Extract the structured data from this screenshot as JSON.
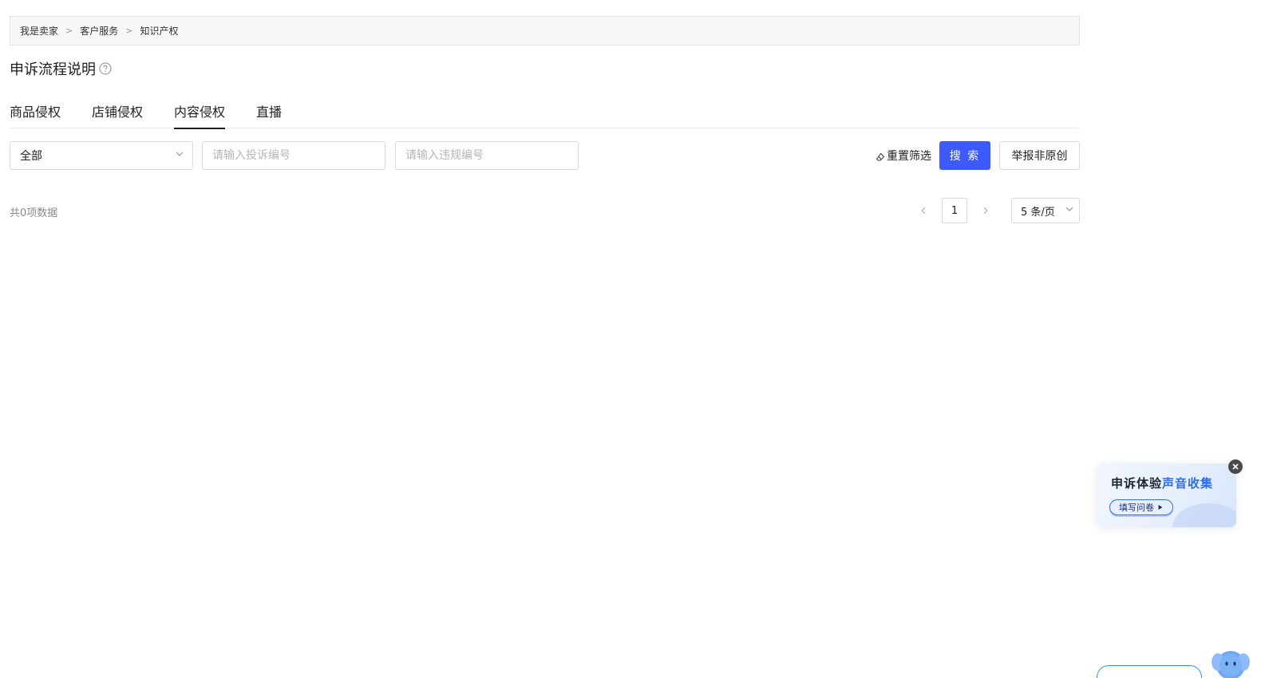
{
  "breadcrumb": {
    "items": [
      "我是卖家",
      "客户服务",
      "知识产权"
    ],
    "separator": ">"
  },
  "page": {
    "title": "申诉流程说明",
    "help_icon": "question-circle-icon"
  },
  "tabs": {
    "items": [
      "商品侵权",
      "店铺侵权",
      "内容侵权",
      "直播"
    ],
    "active": "内容侵权"
  },
  "filters": {
    "type_select": {
      "value": "全部",
      "icon": "chevron-down-icon"
    },
    "complaint_id": {
      "placeholder": "请输入投诉编号",
      "value": ""
    },
    "violation_id": {
      "placeholder": "请输入违规编号",
      "value": ""
    },
    "reset_label": "重置筛选",
    "search_label": "搜 索",
    "report_label": "举报非原创"
  },
  "results": {
    "total_text": "共0项数据"
  },
  "pagination": {
    "current_page": "1",
    "page_size": "5 条/页"
  },
  "survey": {
    "title_dark": "申诉体验",
    "title_blue": "声音收集",
    "button_label": "填写问卷"
  },
  "colors": {
    "primary": "#3d5aff",
    "accent_blue": "#2f6df0",
    "border": "#d9d9d9",
    "muted_text": "#8a8a8a"
  }
}
